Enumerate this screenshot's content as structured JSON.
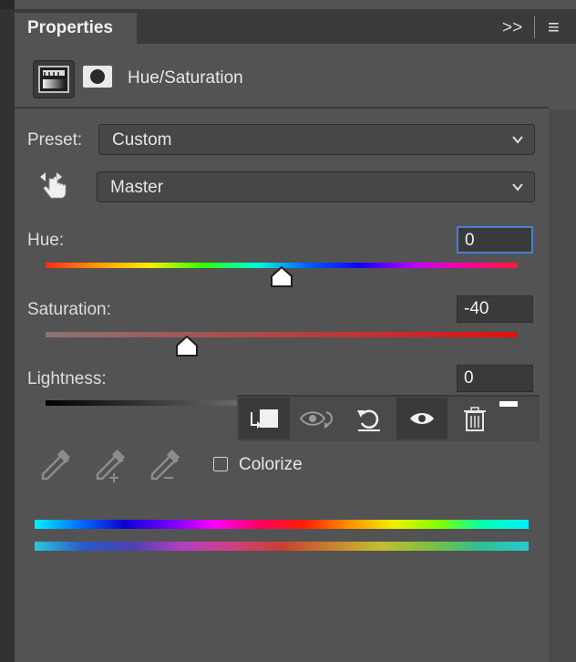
{
  "window": {
    "tab_title": "Properties",
    "expand_glyph": ">>",
    "menu_glyph": "≡"
  },
  "header": {
    "adjustment_name": "Hue/Saturation",
    "adjustment_icon": "hue-saturation-layer-icon",
    "mask_icon": "layer-mask-icon"
  },
  "preset": {
    "label": "Preset:",
    "value": "Custom"
  },
  "channel": {
    "value": "Master",
    "icon": "on-image-adjust-hand-icon"
  },
  "hue": {
    "label": "Hue:",
    "value": "0",
    "slider_position": 0.5
  },
  "saturation": {
    "label": "Saturation:",
    "value": "-40",
    "slider_position": 0.3
  },
  "lightness": {
    "label": "Lightness:",
    "value": "0",
    "slider_position": 0.5
  },
  "tools": [
    {
      "name": "clip-to-layer-icon",
      "selected": true
    },
    {
      "name": "view-previous-state-icon",
      "selected": false
    },
    {
      "name": "reset-icon",
      "selected": false
    },
    {
      "name": "visibility-eye-icon",
      "selected": true
    },
    {
      "name": "trash-icon",
      "selected": false
    }
  ],
  "eyedroppers": [
    "eyedropper-icon",
    "eyedropper-plus-icon",
    "eyedropper-minus-icon"
  ],
  "colorize": {
    "label": "Colorize",
    "checked": false
  },
  "colors": {
    "panel": "#535353",
    "field": "#3a3a3a",
    "accent": "#4a7fd0"
  }
}
